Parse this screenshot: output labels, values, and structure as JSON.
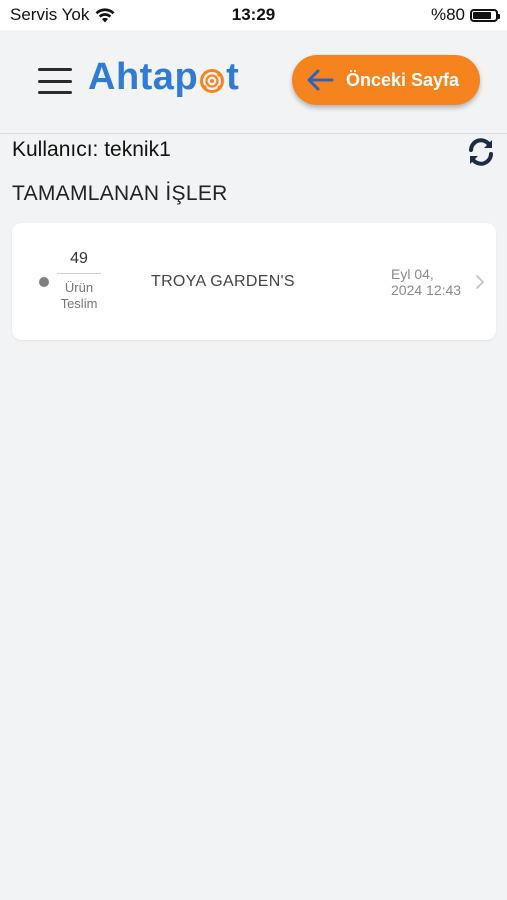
{
  "status_bar": {
    "carrier": "Servis Yok",
    "time": "13:29",
    "battery": "%80",
    "battery_level": 0.8
  },
  "header": {
    "logo_text_start": "Ahtap",
    "logo_text_end": "t",
    "back_button_label": "Önceki Sayfa",
    "colors": {
      "brand_blue": "#2f7bd6",
      "accent_orange": "#f6841e"
    }
  },
  "user": {
    "label": "Kullanıcı: teknik1"
  },
  "section": {
    "title": "TAMAMLANAN İŞLER"
  },
  "jobs": [
    {
      "count": "49",
      "type_line1": "Ürün",
      "type_line2": "Teslim",
      "title": "TROYA GARDEN'S",
      "date_line1": "Eyl 04,",
      "date_line2": "2024 12:43",
      "status_color": "#7f7f7f"
    }
  ],
  "icons": {
    "menu": "hamburger-menu-icon",
    "back": "arrow-left-icon",
    "refresh": "refresh-icon",
    "chevron": "chevron-right-icon",
    "wifi": "wifi-icon",
    "battery": "battery-icon"
  }
}
